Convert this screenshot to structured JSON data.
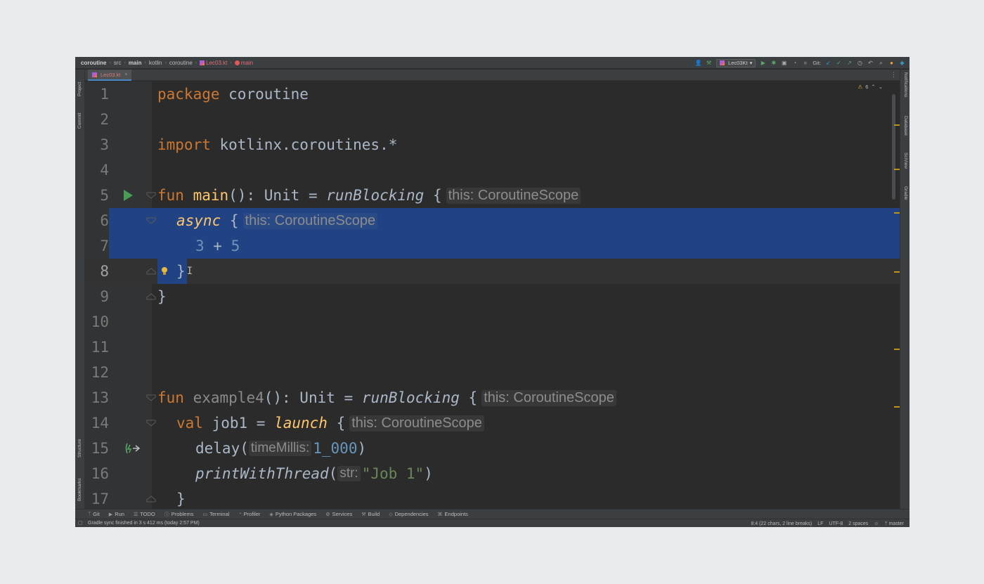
{
  "navbar": {
    "breadcrumbs": [
      "coroutine",
      "src",
      "main",
      "kotlin",
      "coroutine",
      "Lec03.kt",
      "main"
    ],
    "run_config": "Lec03Kt",
    "git_label": "Git:"
  },
  "tabs": [
    {
      "label": "Lec03.kt",
      "active": true
    }
  ],
  "left_strip": [
    "Project",
    "Commit",
    "Structure",
    "Bookmarks"
  ],
  "right_strip": [
    "Notifications",
    "Database",
    "SciView",
    "Gradle"
  ],
  "inspections": {
    "warning_count": "6"
  },
  "editor": {
    "line_numbers": [
      "1",
      "2",
      "3",
      "4",
      "5",
      "6",
      "7",
      "8",
      "9",
      "10",
      "11",
      "12",
      "13",
      "14",
      "15",
      "16",
      "17"
    ],
    "lines": {
      "l1": {
        "kw": "package",
        "rest": " coroutine"
      },
      "l3": {
        "kw": "import",
        "rest": " kotlinx.coroutines.*"
      },
      "l5": {
        "kw": "fun",
        "name": " main",
        "sig": "(): Unit = ",
        "call": "runBlocking",
        "brace": " {",
        "hint": "this: CoroutineScope"
      },
      "l6": {
        "call": "async",
        "brace": " {",
        "hint": "this: CoroutineScope"
      },
      "l7": {
        "a": "3",
        "op": " + ",
        "b": "5"
      },
      "l8": {
        "brace": "}"
      },
      "l9": {
        "brace": "}"
      },
      "l13": {
        "kw": "fun",
        "name": " example4",
        "sig": "(): Unit = ",
        "call": "runBlocking",
        "brace": " {",
        "hint": "this: CoroutineScope"
      },
      "l14": {
        "kw": "val",
        "mid": " job1 = ",
        "call": "launch",
        "brace": " {",
        "hint": "this: CoroutineScope"
      },
      "l15": {
        "fn": "delay(",
        "phint": "timeMillis:",
        "arg": "1_000",
        "close": ")"
      },
      "l16": {
        "fn": "printWithThread",
        "open": "(",
        "phint": "str:",
        "arg": "\"Job 1\"",
        "close": ")"
      },
      "l17": {
        "brace": "}"
      }
    }
  },
  "tool_windows": [
    "Git",
    "Run",
    "TODO",
    "Problems",
    "Terminal",
    "Profiler",
    "Python Packages",
    "Services",
    "Build",
    "Dependencies",
    "Endpoints"
  ],
  "status": {
    "message": "Gradle sync finished in 3 s 412 ms (today 2:57 PM)",
    "position": "8:4 (22 chars, 2 line breaks)",
    "line_sep": "LF",
    "encoding": "UTF-8",
    "indent": "2 spaces",
    "branch": "master"
  },
  "colors": {
    "keyword": "#cc7832",
    "function": "#ffc66d",
    "number": "#6897bb",
    "string": "#6a8759",
    "selection": "#214283"
  }
}
